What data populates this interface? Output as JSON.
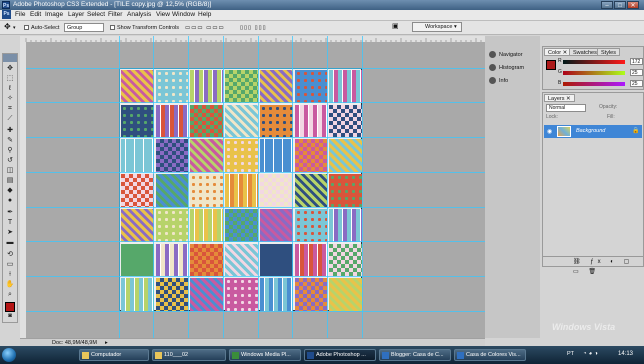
{
  "window": {
    "title": "Adobe Photoshop CS3 Extended - [TILE copy.jpg @ 12,5% (RGB/8)]",
    "app_icon": "Ps"
  },
  "menu": [
    "File",
    "Edit",
    "Image",
    "Layer",
    "Select",
    "Filter",
    "Analysis",
    "View",
    "Window",
    "Help"
  ],
  "options": {
    "auto_select_label": "Auto-Select",
    "auto_select_value": "Group",
    "transform_label": "Show Transform Controls",
    "workspace_label": "Workspace"
  },
  "status": {
    "doc": "Doc: 48,9M/48,9M"
  },
  "dock": {
    "items": [
      "Navigator",
      "Histogram",
      "Info"
    ]
  },
  "color_panel": {
    "tabs": [
      "Color",
      "Swatches",
      "Styles"
    ],
    "r": "172",
    "g": "25",
    "b": "25",
    "labels": [
      "R",
      "G",
      "B"
    ],
    "swatch": "#ac1919"
  },
  "layers_panel": {
    "tab": "Layers",
    "blend_mode": "Normal",
    "opacity_label": "Opacity:",
    "fill_label": "Fill:",
    "lock_label": "Lock:",
    "layer_name": "Background"
  },
  "taskbar": {
    "items": [
      "Computador",
      "110___02",
      "Windows Media Pl...",
      "Adobe Photoshop ...",
      "Blogger: Casa de C...",
      "Casa de Colores Vis..."
    ],
    "clock": "14:13",
    "lang": "PT"
  },
  "os_logo": "Windows Vista"
}
